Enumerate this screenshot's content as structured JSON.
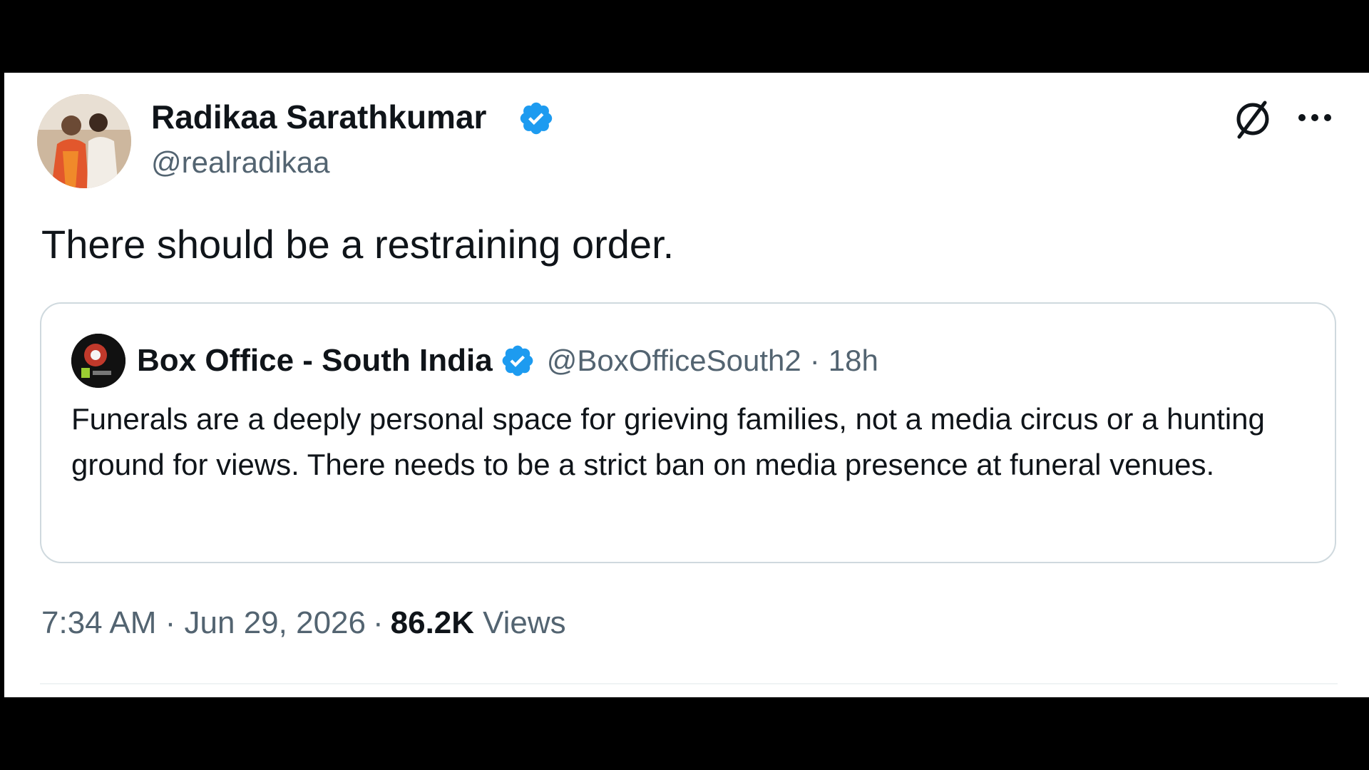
{
  "tweet": {
    "author": {
      "name": "Radikaa Sarathkumar",
      "handle": "@realradikaa",
      "verified": true
    },
    "text": "There should be a restraining order.",
    "timestamp": "7:34 AM · Jun 29, 2026",
    "separator": "·",
    "views_count": "86.2K",
    "views_label": "Views"
  },
  "quoted_tweet": {
    "author": {
      "name": "Box Office - South India",
      "handle": "@BoxOfficeSouth2",
      "verified": true
    },
    "separator": "·",
    "time": "18h",
    "text": "Funerals are a deeply personal space for grieving families, not a media circus or a hunting ground for views. There needs to be a strict ban on media presence at funeral venues."
  },
  "icons": {
    "verified": "verified-badge-icon",
    "grok": "grok-icon",
    "more": "more-options-icon"
  },
  "colors": {
    "verified_blue": "#1d9bf0",
    "text_primary": "#0f1419",
    "text_secondary": "#536471",
    "border": "#cfd9de"
  }
}
